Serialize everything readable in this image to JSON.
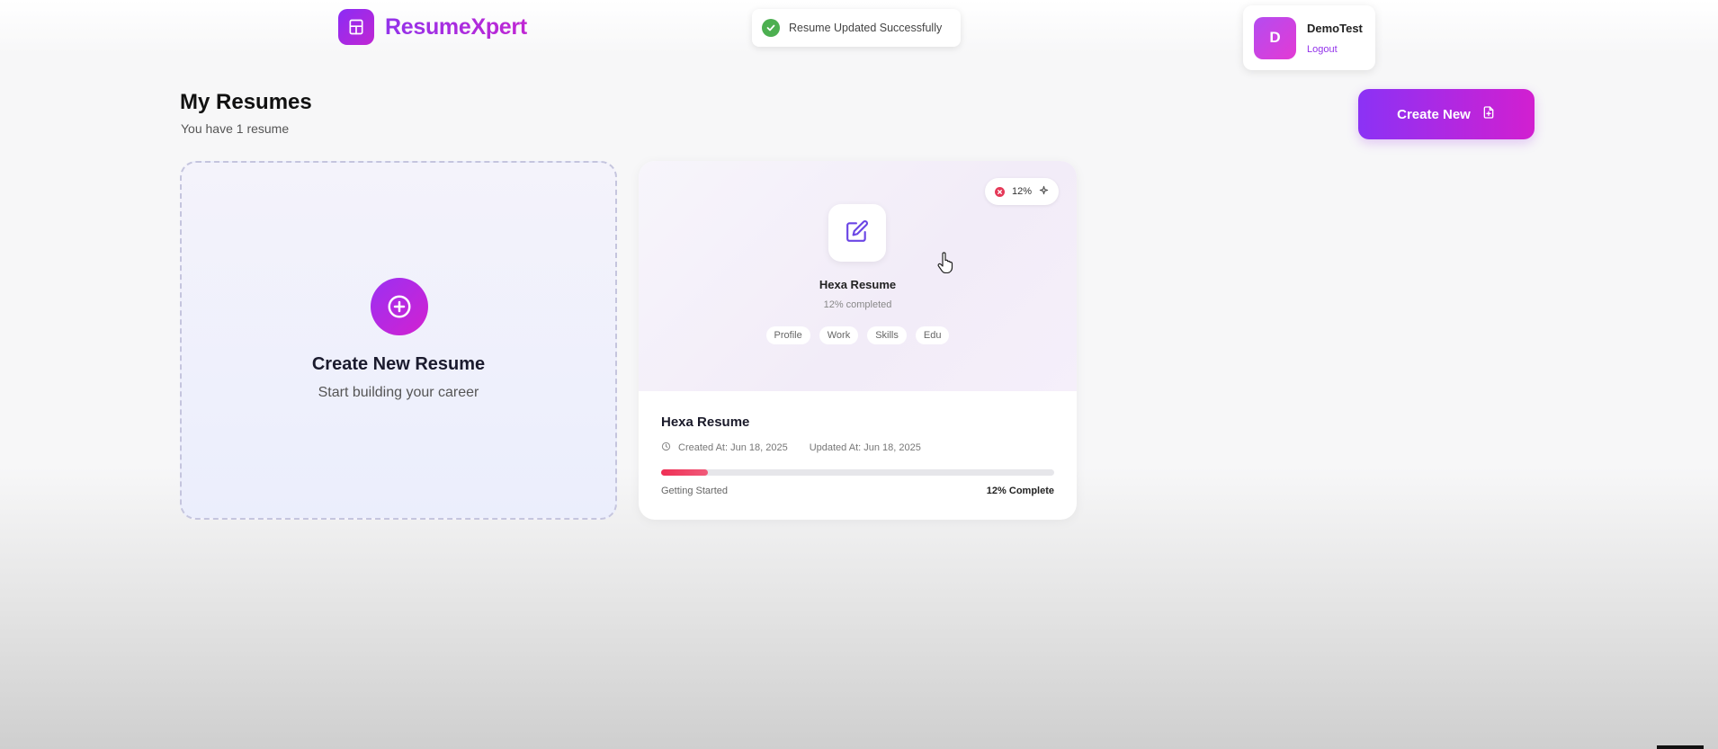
{
  "header": {
    "app_name": "ResumeXpert",
    "toast": "Resume Updated Successfully",
    "user": {
      "initial": "D",
      "name": "DemoTest",
      "logout_label": "Logout"
    }
  },
  "page": {
    "title": "My Resumes",
    "subtitle": "You have 1 resume",
    "create_new_label": "Create New"
  },
  "create_card": {
    "title": "Create New Resume",
    "subtitle": "Start building your career"
  },
  "resumes": [
    {
      "preview_name": "Hexa Resume",
      "percent_badge": "12%",
      "completed_text": "12% completed",
      "sections": [
        "Profile",
        "Work",
        "Skills",
        "Edu"
      ],
      "name": "Hexa Resume",
      "created": "Created At: Jun 18, 2025",
      "updated": "Updated At: Jun 18, 2025",
      "progress": 0.12,
      "stage": "Getting Started",
      "complete_label": "12% Complete"
    }
  ],
  "colors": {
    "brand_gradient_start": "#8b32f5",
    "brand_gradient_end": "#d21fd0",
    "progress": "#ef2f55",
    "success": "#4caf50"
  }
}
